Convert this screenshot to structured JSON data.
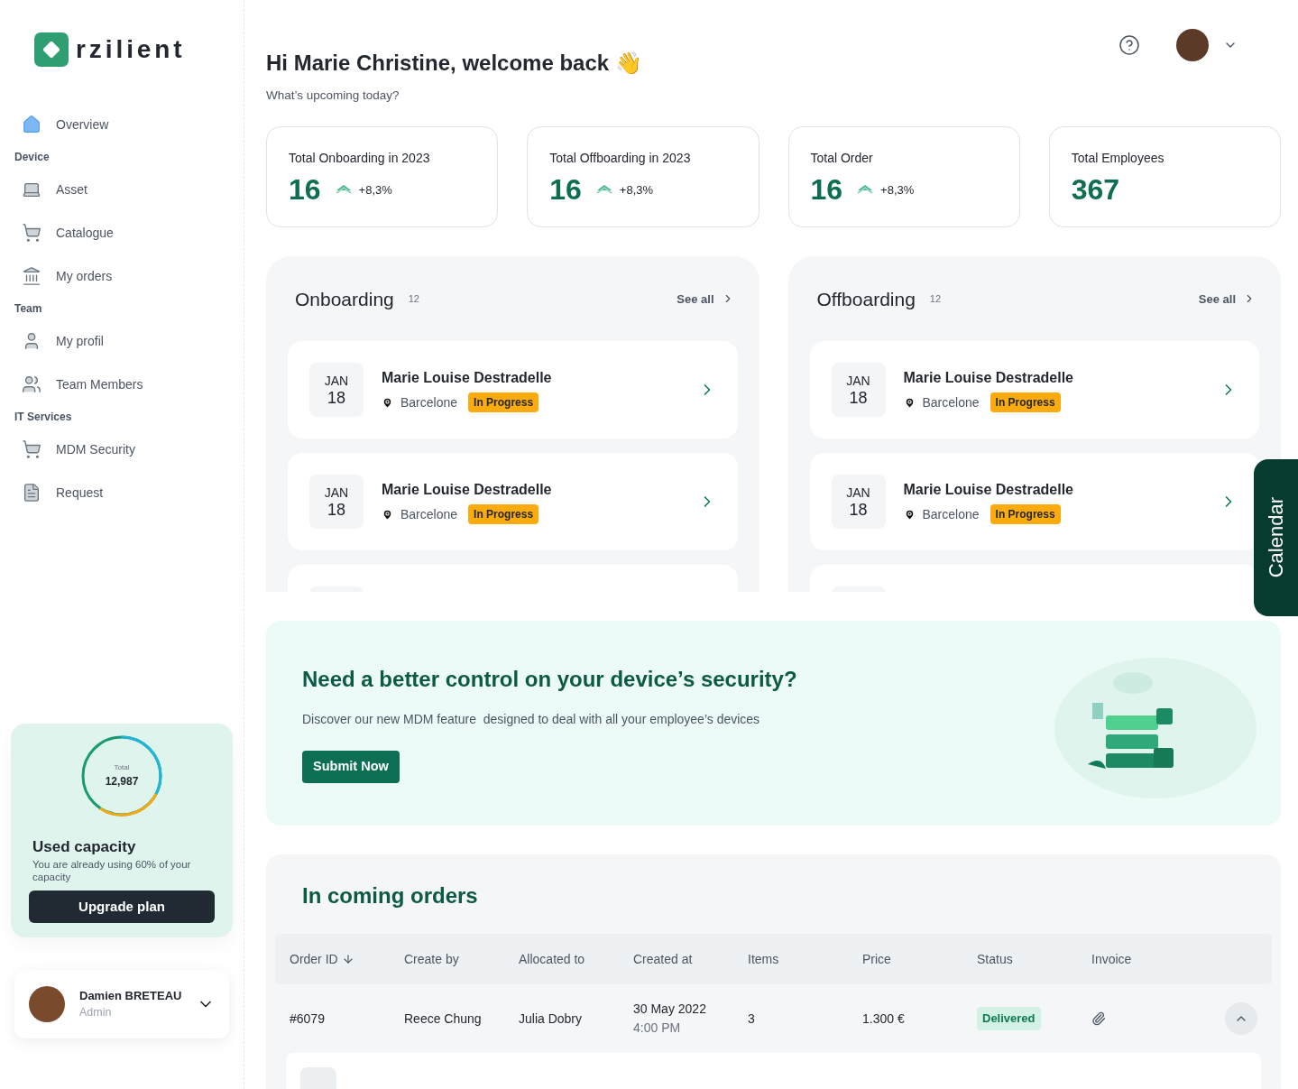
{
  "brand": {
    "name": "rzilient"
  },
  "sidebar": {
    "items": [
      {
        "kind": "link",
        "label": "Overview",
        "selected": true
      },
      {
        "kind": "section",
        "label": "Device"
      },
      {
        "kind": "link",
        "label": "Asset",
        "selected": false
      },
      {
        "kind": "link",
        "label": "Catalogue",
        "selected": false
      },
      {
        "kind": "link",
        "label": "My orders",
        "selected": false
      },
      {
        "kind": "section",
        "label": "Team"
      },
      {
        "kind": "link",
        "label": "My profil",
        "selected": false
      },
      {
        "kind": "link",
        "label": "Team Members",
        "selected": false
      },
      {
        "kind": "section",
        "label": "IT Services"
      },
      {
        "kind": "link",
        "label": "MDM Security",
        "selected": false
      },
      {
        "kind": "link",
        "label": "Request",
        "selected": false
      }
    ],
    "capacity": {
      "total_label": "Total",
      "total": "12,987",
      "title": "Used capacity",
      "text": "You are already using 60% of your capacity",
      "button": "Upgrade plan"
    },
    "user": {
      "name": "Damien BRETEAU",
      "role": "Admin"
    }
  },
  "header": {
    "greeting": "Hi Marie Christine, welcome back 👋",
    "subtitle": "What’s upcoming today?"
  },
  "stats": [
    {
      "label": "Total Onboarding in 2023",
      "value": "16",
      "change": "+8,3%"
    },
    {
      "label": "Total Offboarding in 2023",
      "value": "16",
      "change": "+8,3%"
    },
    {
      "label": "Total Order",
      "value": "16",
      "change": "+8,3%"
    },
    {
      "label": "Total Employees",
      "value": "367"
    }
  ],
  "panels": [
    {
      "title": "Onboarding",
      "count": "12",
      "link": "See all",
      "entries": [
        {
          "month": "JAN",
          "day": "18",
          "name": "Marie Louise Destradelle",
          "place": "Barcelone",
          "status": "In Progress"
        },
        {
          "month": "JAN",
          "day": "18",
          "name": "Marie Louise Destradelle",
          "place": "Barcelone",
          "status": "In Progress"
        }
      ]
    },
    {
      "title": "Offboarding",
      "count": "12",
      "link": "See all",
      "entries": [
        {
          "month": "JAN",
          "day": "18",
          "name": "Marie Louise Destradelle",
          "place": "Barcelone",
          "status": "In Progress"
        },
        {
          "month": "JAN",
          "day": "18",
          "name": "Marie Louise Destradelle",
          "place": "Barcelone",
          "status": "In Progress"
        }
      ]
    }
  ],
  "calendar_tab": {
    "label": "Calendar"
  },
  "banner": {
    "title": "Need a better control on your device’s security?",
    "text": "Discover our new MDM feature  designed to deal with all your employee’s devices",
    "button": "Submit Now"
  },
  "orders": {
    "title": "In coming orders",
    "columns": [
      "Order ID",
      "Create by",
      "Allocated to",
      "Created at",
      "Items",
      "Price",
      "Status",
      "Invoice"
    ],
    "rows": [
      {
        "id": "#6079",
        "created_by": "Reece Chung",
        "allocated_to": "Julia Dobry",
        "date": "30 May 2022",
        "time": "4:00 PM",
        "items": "3",
        "price": "1.300 €",
        "status": "Delivered",
        "expanded": true
      }
    ]
  }
}
